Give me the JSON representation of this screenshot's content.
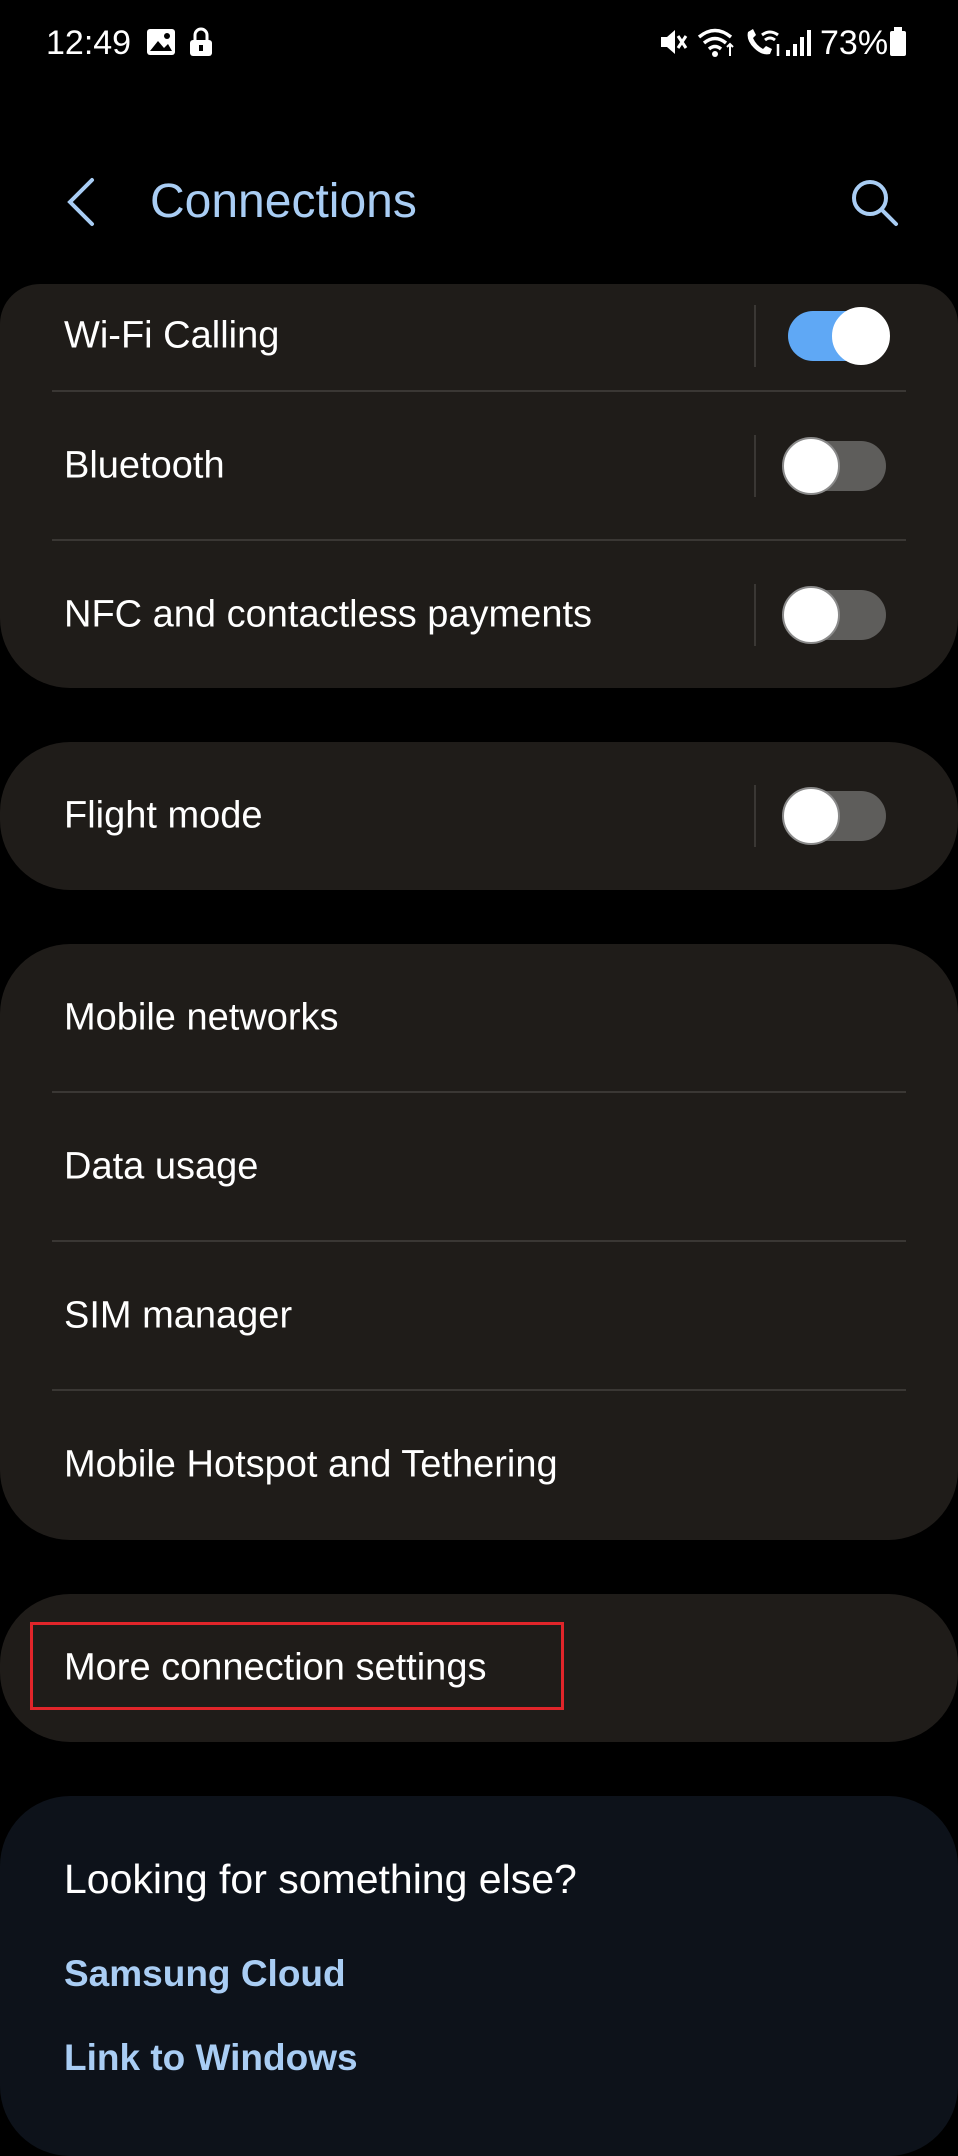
{
  "status_bar": {
    "time": "12:49",
    "battery": "73%",
    "icons": [
      "gallery-icon",
      "lock-icon",
      "mute-icon",
      "wifi-icon",
      "wifi-calling-icon",
      "signal-icon",
      "battery-icon"
    ]
  },
  "header": {
    "title": "Connections",
    "back_icon": "chevron-left-icon",
    "search_icon": "search-icon"
  },
  "groups": {
    "wireless": [
      {
        "label": "Wi-Fi Calling",
        "toggle": true
      },
      {
        "label": "Bluetooth",
        "toggle": false
      },
      {
        "label": "NFC and contactless payments",
        "toggle": false
      }
    ],
    "flight": {
      "label": "Flight mode",
      "toggle": false
    },
    "mobile": [
      {
        "label": "Mobile networks"
      },
      {
        "label": "Data usage"
      },
      {
        "label": "SIM manager"
      },
      {
        "label": "Mobile Hotspot and Tethering"
      }
    ],
    "more": {
      "label": "More connection settings"
    }
  },
  "suggestions": {
    "title": "Looking for something else?",
    "links": [
      "Samsung Cloud",
      "Link to Windows"
    ]
  },
  "colors": {
    "background": "#000000",
    "card": "#1f1c19",
    "suggest_card": "#0d121a",
    "accent": "#a9cdf4",
    "toggle_on": "#5fa8f5",
    "toggle_off": "#5e5d5b",
    "highlight": "#e0252a"
  }
}
